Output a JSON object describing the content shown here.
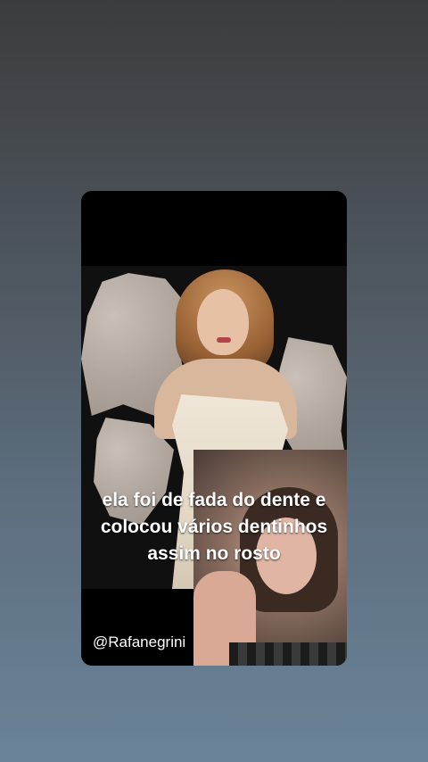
{
  "caption": {
    "lines": [
      "ela foi de fada do dente e",
      "colocou vários dentinhos",
      "assim no rosto"
    ]
  },
  "creator": {
    "handle": "@Rafanegrini"
  },
  "colors": {
    "background_top": "#3b3c3e",
    "background_bottom": "#6a8399",
    "caption_text": "#ffffff",
    "card_background": "#000000"
  }
}
